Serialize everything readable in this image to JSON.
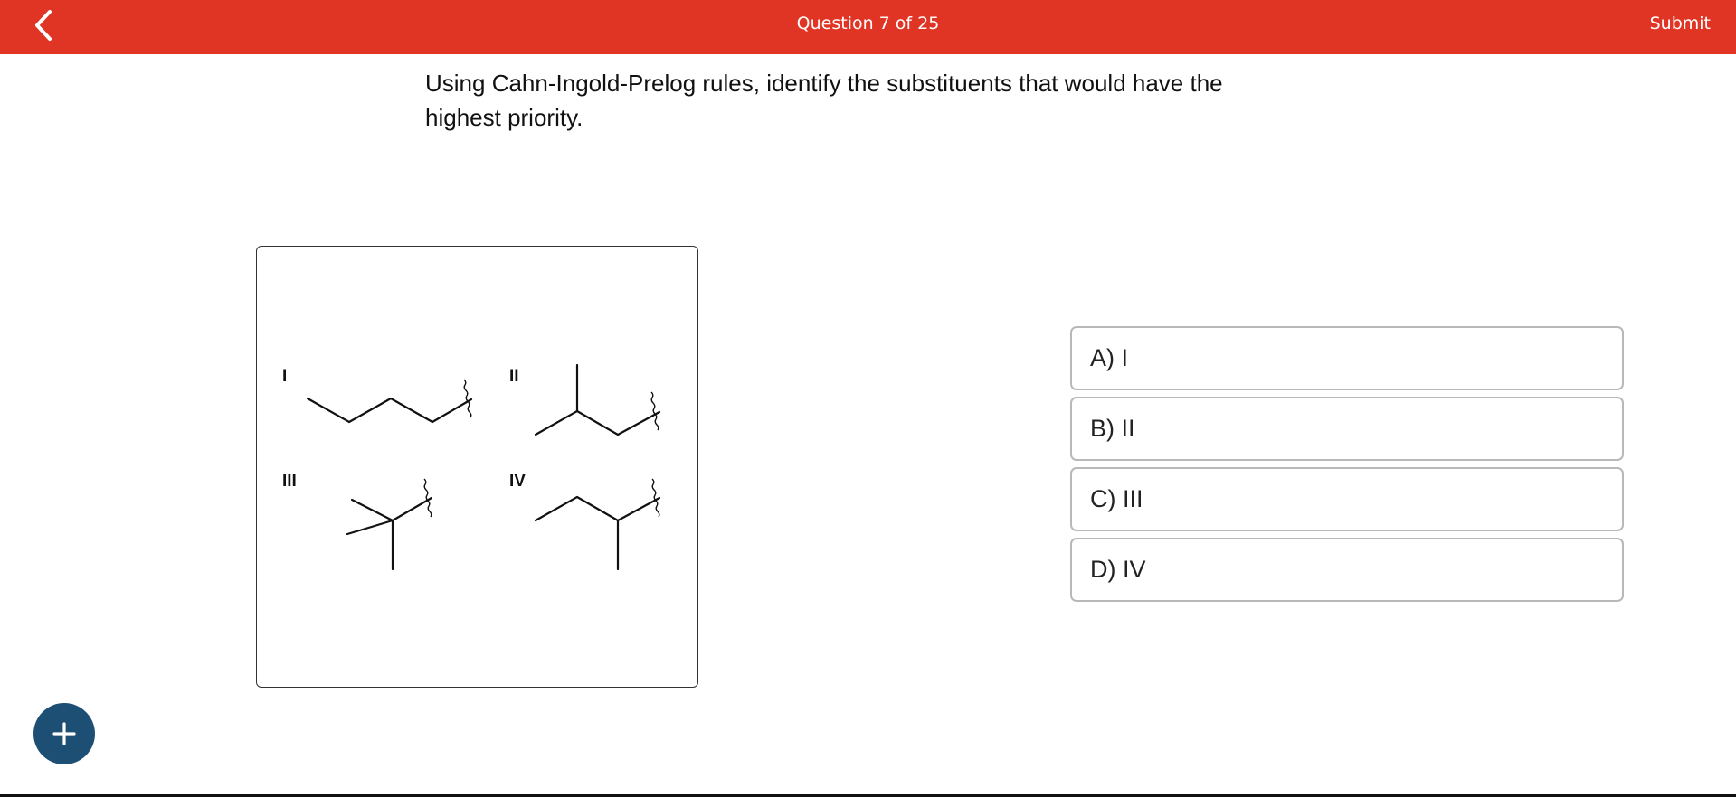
{
  "header": {
    "title": "Question 7 of 25",
    "submit_label": "Submit",
    "background_color": "#e03524"
  },
  "question": {
    "text": "Using Cahn-Ingold-Prelog rules, identify the substituents that would have the highest priority."
  },
  "structures": {
    "labels": [
      "I",
      "II",
      "III",
      "IV"
    ]
  },
  "options": [
    {
      "label": "A) I"
    },
    {
      "label": "B) II"
    },
    {
      "label": "C) III"
    },
    {
      "label": "D) IV"
    }
  ],
  "icons": {
    "back": "chevron-left-icon",
    "fab": "plus-icon"
  },
  "colors": {
    "fab": "#1d4e73",
    "option_border": "#b8b8b8"
  }
}
